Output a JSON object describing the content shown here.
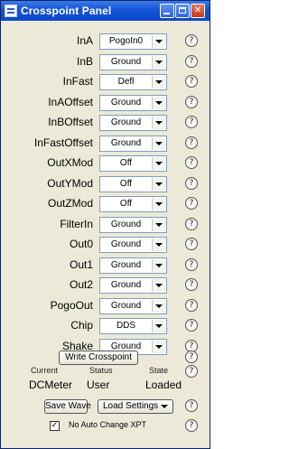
{
  "window": {
    "title": "Crosspoint Panel",
    "controls": {
      "minimize": "minimize-icon",
      "maximize": "maximize-icon",
      "close": "close-icon",
      "close_glyph": "✕"
    }
  },
  "rows": [
    {
      "label": "InA",
      "value": "PogoIn0"
    },
    {
      "label": "InB",
      "value": "Ground"
    },
    {
      "label": "InFast",
      "value": "Defl"
    },
    {
      "label": "InAOffset",
      "value": "Ground"
    },
    {
      "label": "InBOffset",
      "value": "Ground"
    },
    {
      "label": "InFastOffset",
      "value": "Ground"
    },
    {
      "label": "OutXMod",
      "value": "Off"
    },
    {
      "label": "OutYMod",
      "value": "Off"
    },
    {
      "label": "OutZMod",
      "value": "Off"
    },
    {
      "label": "FilterIn",
      "value": "Ground"
    },
    {
      "label": "Out0",
      "value": "Ground"
    },
    {
      "label": "Out1",
      "value": "Ground"
    },
    {
      "label": "Out2",
      "value": "Ground"
    },
    {
      "label": "PogoOut",
      "value": "Ground"
    },
    {
      "label": "Chip",
      "value": "DDS"
    },
    {
      "label": "Shake",
      "value": "Ground"
    }
  ],
  "help_glyph": "?",
  "write_button": "Write Crosspoint",
  "status": {
    "headers": {
      "current": "Current",
      "status": "Status",
      "state": "State"
    },
    "values": {
      "current": "DCMeter",
      "status": "User",
      "state": "Loaded"
    }
  },
  "save_button": "Save Wave",
  "load_settings": "Load Settings",
  "checkbox": {
    "checked": true,
    "mark": "✓",
    "label": "No Auto Change XPT"
  }
}
